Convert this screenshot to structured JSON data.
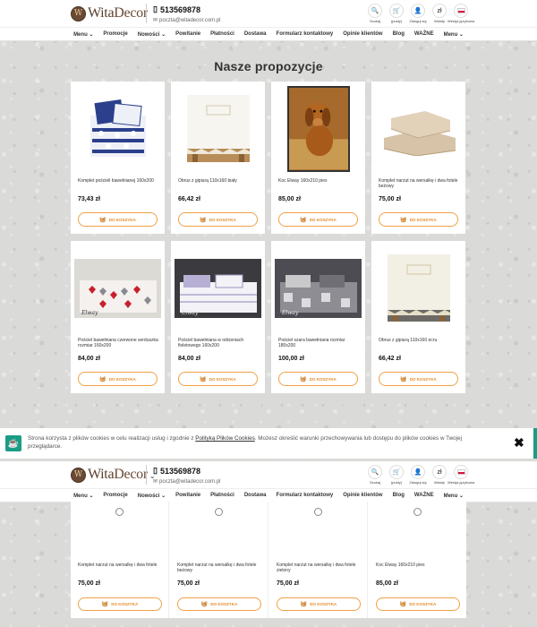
{
  "header": {
    "logo_wita": "Wita",
    "logo_decor": "Decor",
    "logo_mark": "W",
    "phone": "513569878",
    "email": "poczta@witadecor.com.pl",
    "icons": [
      {
        "name": "search-icon",
        "glyph": "🔍",
        "label": "Szukaj"
      },
      {
        "name": "cart-icon",
        "glyph": "🛒",
        "label": "(pusty)"
      },
      {
        "name": "user-icon",
        "glyph": "👤",
        "label": "Zaloguj się"
      },
      {
        "name": "currency-icon",
        "glyph": "zł",
        "label": "Waluty"
      },
      {
        "name": "language-flag-icon",
        "glyph": "",
        "label": "Wersja językowa"
      }
    ]
  },
  "nav": [
    "Menu ⌄",
    "Promocje",
    "Nowości ⌄",
    "Powitanie",
    "Płatności",
    "Dostawa",
    "Formularz kontaktowy",
    "Opinie klientów",
    "Blog",
    "WAŻNE",
    "Menu ⌄"
  ],
  "section_title": "Nasze propozycje",
  "add_to_cart_label": "DO KOSZYKA",
  "products": [
    {
      "name": "Komplet pościeli bawełnianej 160x200",
      "price": "73,43 zł"
    },
    {
      "name": "Obrus z gipiurą 110x160 biały",
      "price": "66,42 zł"
    },
    {
      "name": "Koc Elway 160x210 pies",
      "price": "85,00 zł"
    },
    {
      "name": "Komplet narzut na wersalkę i dwa fotele beżowy",
      "price": "75,00 zł"
    },
    {
      "name": "Pościel bawełniana czerwone serduszka rozmiar 160x200",
      "price": "84,00 zł"
    },
    {
      "name": "Pościel bawełniana w odcieniach fioletowego 160x200",
      "price": "84,00 zł"
    },
    {
      "name": "Pościel szara bawełniana rozmiar 180x200",
      "price": "100,00 zł"
    },
    {
      "name": "Obrus z gipiurą 110x160 ecru",
      "price": "66,42 zł"
    }
  ],
  "cookie": {
    "text_before": "Strona korzysta z plików cookies w celu realizacji usług i zgodnie z ",
    "link": "Polityką Plików Cookies",
    "text_after": ". Możesz określić warunki przechowywania lub dostępu do plików cookies w Twojej przeglądarce.",
    "close": "✖"
  },
  "bottom_products": [
    {
      "name": "Komplet narzut na wersalkę i dwa fotele",
      "price": "75,00 zł"
    },
    {
      "name": "Komplet narzut na wersalkę i dwa fotele beżowy",
      "price": "75,00 zł"
    },
    {
      "name": "Komplet narzut na wersalkę i dwa fotele zielony",
      "price": "75,00 zł"
    },
    {
      "name": "Koc Elway 160x210 pies",
      "price": "85,00 zł"
    }
  ],
  "colors": {
    "accent": "#f1a046",
    "cookie_teal": "#1b9c85",
    "logo_brown": "#5a3d2b"
  }
}
